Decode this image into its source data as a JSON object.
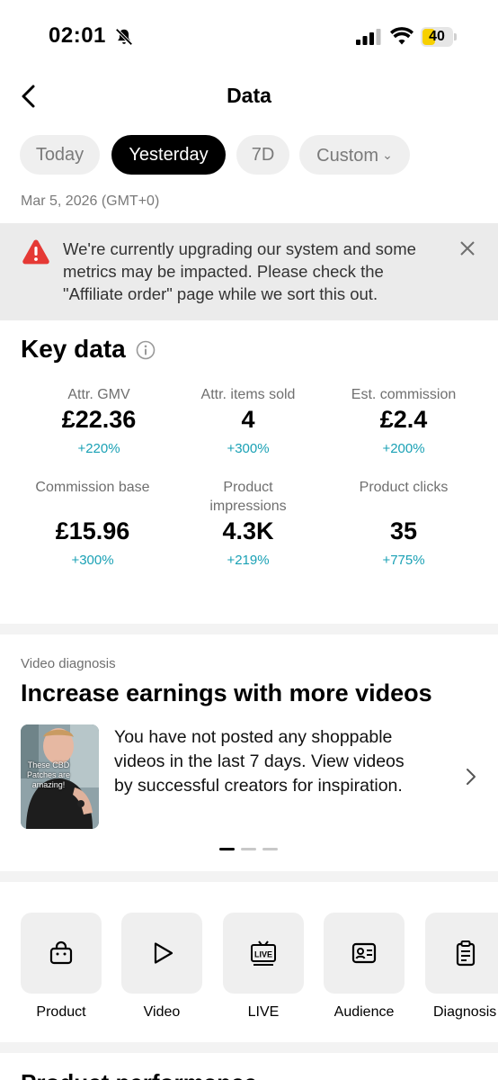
{
  "status_bar": {
    "time": "02:01",
    "battery": "40"
  },
  "header": {
    "title": "Data"
  },
  "tabs": [
    {
      "label": "Today",
      "active": false
    },
    {
      "label": "Yesterday",
      "active": true
    },
    {
      "label": "7D",
      "active": false
    },
    {
      "label": "Custom",
      "active": false
    }
  ],
  "date_range": "Mar 5, 2026 (GMT+0)",
  "notice": {
    "line1": "We're currently upgrading our system and some",
    "line2": "metrics may be impacted. Please check the",
    "line3": "\"Affiliate order\" page while we sort this out."
  },
  "key_data": {
    "title": "Key data",
    "metrics": [
      {
        "label": "Attr. GMV",
        "label2": "",
        "value": "£22.36",
        "change": "+220%"
      },
      {
        "label": "Attr. items sold",
        "label2": "",
        "value": "4",
        "change": "+300%"
      },
      {
        "label": "Est. commission",
        "label2": "",
        "value": "£2.4",
        "change": "+200%"
      },
      {
        "label": "Commission base",
        "label2": "",
        "value": "£15.96",
        "change": "+300%"
      },
      {
        "label": "Product",
        "label2": "impressions",
        "value": "4.3K",
        "change": "+219%"
      },
      {
        "label": "Product clicks",
        "label2": "",
        "value": "35",
        "change": "+775%"
      }
    ]
  },
  "video_diagnosis": {
    "label": "Video diagnosis",
    "title": "Increase earnings with more videos",
    "thumb_caption": "These CBD Patches are amazing!",
    "line1": "You have not posted any shoppable",
    "line2": "videos in the last 7 days. View videos",
    "line3": "by successful creators for inspiration."
  },
  "nav_tiles": [
    {
      "label": "Product",
      "icon": "shopping-bag-icon"
    },
    {
      "label": "Video",
      "icon": "play-icon"
    },
    {
      "label": "LIVE",
      "icon": "live-tv-icon"
    },
    {
      "label": "Audience",
      "icon": "id-card-icon"
    },
    {
      "label": "Diagnosis",
      "icon": "clipboard-icon"
    }
  ],
  "bottom_peek": "Product performance"
}
